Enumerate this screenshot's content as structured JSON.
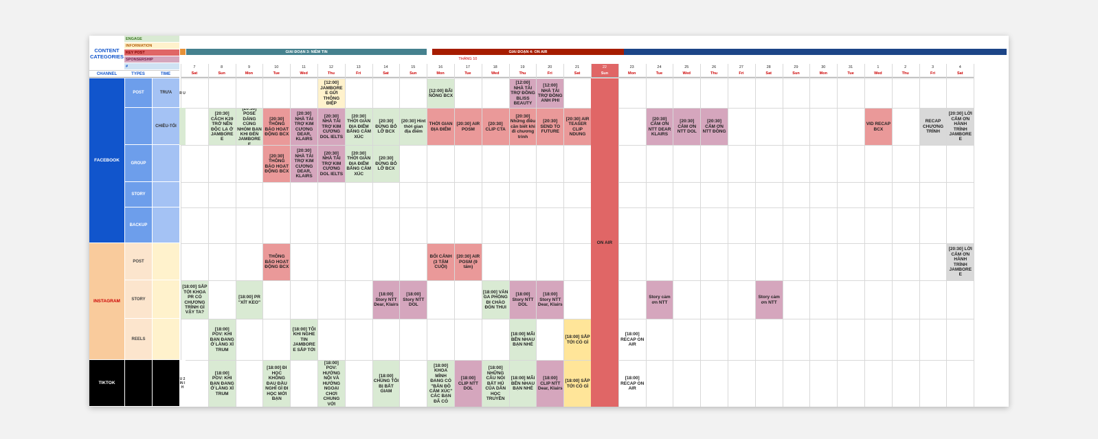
{
  "legend": {
    "title": "CONTENT CATEGORIES",
    "items": [
      {
        "label": "ENGAGE",
        "color": "#d9ead3",
        "text": "#38761d"
      },
      {
        "label": "INFORMATION",
        "color": "#fff2cc",
        "text": "#b45f06"
      },
      {
        "label": "KEY POST",
        "color": "#e06666",
        "text": "#7f0000"
      },
      {
        "label": "SPONSERSHIP",
        "color": "#d5a6bd",
        "text": "#741b47"
      },
      {
        "label": "#",
        "color": "#cfe2f3",
        "text": "#1155cc"
      }
    ]
  },
  "phases": [
    {
      "label": "GIAI ĐOẠN 3: NIỀM TIN",
      "color": "#45818e",
      "start": 0,
      "end": 9
    },
    {
      "label": "GIAI ĐOẠN 4: ON AIR",
      "color": "#a61c00",
      "start": 9,
      "end": 16
    },
    {
      "label": "",
      "color": "#1c4587",
      "start": 16,
      "end": 30
    }
  ],
  "month_label": "THÁNG 10",
  "headers": {
    "channel": "CHANNEL",
    "types": "TYPES",
    "time": "TIME"
  },
  "days": [
    {
      "d": "7",
      "w": "Sat"
    },
    {
      "d": "8",
      "w": "Sun"
    },
    {
      "d": "9",
      "w": "Mon"
    },
    {
      "d": "10",
      "w": "Tue"
    },
    {
      "d": "11",
      "w": "Wed"
    },
    {
      "d": "12",
      "w": "Thu"
    },
    {
      "d": "13",
      "w": "Fri"
    },
    {
      "d": "14",
      "w": "Sat"
    },
    {
      "d": "15",
      "w": "Sun"
    },
    {
      "d": "16",
      "w": "Mon"
    },
    {
      "d": "17",
      "w": "Tue"
    },
    {
      "d": "18",
      "w": "Wed"
    },
    {
      "d": "19",
      "w": "Thu"
    },
    {
      "d": "20",
      "w": "Fri"
    },
    {
      "d": "21",
      "w": "Sat"
    },
    {
      "d": "22",
      "w": "Sun"
    },
    {
      "d": "23",
      "w": "Mon"
    },
    {
      "d": "24",
      "w": "Tue"
    },
    {
      "d": "25",
      "w": "Wed"
    },
    {
      "d": "26",
      "w": "Thu"
    },
    {
      "d": "27",
      "w": "Fri"
    },
    {
      "d": "28",
      "w": "Sat"
    },
    {
      "d": "29",
      "w": "Sun"
    },
    {
      "d": "30",
      "w": "Mon"
    },
    {
      "d": "31",
      "w": "Tue"
    },
    {
      "d": "1",
      "w": "Wed"
    },
    {
      "d": "2",
      "w": "Thu"
    },
    {
      "d": "3",
      "w": "Fri"
    },
    {
      "d": "4",
      "w": "Sat"
    }
  ],
  "on_air_label": "ON AIR",
  "channels": [
    {
      "label": "FACEBOOK",
      "color": "#1155cc",
      "text_color": "#ffffff",
      "rows": [
        0,
        5
      ]
    },
    {
      "label": "INSTAGRAM",
      "color": "#f9cb9c",
      "text_color": "#cc0000",
      "rows": [
        5,
        8
      ]
    },
    {
      "label": "TIKTOK",
      "color": "#000000",
      "text_color": "#ffffff",
      "rows": [
        8,
        9
      ]
    }
  ],
  "rows": [
    {
      "type": "POST",
      "time": "TRƯA",
      "ch": 0
    },
    {
      "type": "",
      "time": "CHIỀU-TỐI",
      "ch": 0
    },
    {
      "type": "GROUP",
      "time": "",
      "ch": 0
    },
    {
      "type": "STORY",
      "time": "",
      "ch": 0
    },
    {
      "type": "BACKUP",
      "time": "",
      "ch": 0
    },
    {
      "type": "POST",
      "time": "",
      "ch": 1
    },
    {
      "type": "STORY",
      "time": "",
      "ch": 1
    },
    {
      "type": "REELS",
      "time": "",
      "ch": 1
    },
    {
      "type": "",
      "time": "",
      "ch": 2
    }
  ],
  "stub_text": [
    "R U",
    "",
    "",
    "",
    "",
    "",
    "",
    "",
    "U 2 IN IH"
  ],
  "colors": {
    "engage": "#d9ead3",
    "info": "#fff2cc",
    "key": "#ea9999",
    "spons": "#d5a6bd",
    "gray": "#d9d9d9",
    "yellow": "#ffe599",
    "onair": "#e06666"
  },
  "events": [
    {
      "r": 0,
      "c": 5,
      "k": "info",
      "t": "[12:00] JAMBOREE GỬI THÔNG ĐIỆP"
    },
    {
      "r": 0,
      "c": 9,
      "k": "engage",
      "t": "[12:00] BÃI NÔNG BCX"
    },
    {
      "r": 0,
      "c": 12,
      "k": "spons",
      "t": "[12:00] NHÀ TÀI TRỢ ĐỒNG BLISS BEAUTY"
    },
    {
      "r": 0,
      "c": 13,
      "k": "spons",
      "t": "[12:00] NHÀ TÀI TRỢ ĐỒNG ANH PHI"
    },
    {
      "r": 1,
      "c": 1,
      "k": "engage",
      "t": "[20:30] CÁCH K29 TRỞ NÊN ĐỘC LẠ Ở JAMBOREE"
    },
    {
      "r": 1,
      "c": 2,
      "k": "engage",
      "t": "[20:30] POSE DÁNG CÙNG NHÓM BẠN KHI ĐẾN JAMBOREE"
    },
    {
      "r": 1,
      "c": 3,
      "k": "key",
      "t": "[20:30] THÔNG BÁO HOẠT ĐỘNG BCX"
    },
    {
      "r": 1,
      "c": 4,
      "k": "spons",
      "t": "[20:30] NHÀ TÀI TRỢ KIM CƯƠNG DEAR, KLAIRS"
    },
    {
      "r": 1,
      "c": 5,
      "k": "spons",
      "t": "[20:30] NHÀ TÀI TRỢ KIM CƯƠNG DOL IELTS"
    },
    {
      "r": 1,
      "c": 6,
      "k": "engage",
      "t": "[20:30] THỜI GIAN ĐỊA ĐIỂM BẰNG CẢM XÚC"
    },
    {
      "r": 1,
      "c": 7,
      "k": "engage",
      "t": "[20:30] ĐỪNG BỎ LỠ BCX"
    },
    {
      "r": 1,
      "c": 8,
      "k": "engage",
      "t": "[20:30] Hint thời gian địa điểm"
    },
    {
      "r": 1,
      "c": 9,
      "k": "key",
      "t": "THỜI GIAN ĐỊA ĐIỂM"
    },
    {
      "r": 1,
      "c": 10,
      "k": "key",
      "t": "[20:30] AIR POSM"
    },
    {
      "r": 1,
      "c": 11,
      "k": "key",
      "t": "[20:30] CLIP CTA"
    },
    {
      "r": 1,
      "c": 12,
      "k": "key",
      "t": "[20:30] Những điều cần biết khi đi chương trình"
    },
    {
      "r": 1,
      "c": 13,
      "k": "key",
      "t": "[20:30] SEND TO FUTURE"
    },
    {
      "r": 1,
      "c": 14,
      "k": "key",
      "t": "[20:30] AIR TEASER CLIP NDUNG"
    },
    {
      "r": 1,
      "c": 17,
      "k": "spons",
      "t": "[20:30] CẢM ƠN NTT DEAR KLAIRS"
    },
    {
      "r": 1,
      "c": 18,
      "k": "spons",
      "t": "[20:30] CẢM ƠN NTT DOL"
    },
    {
      "r": 1,
      "c": 19,
      "k": "spons",
      "t": "[20:30] CẢM ƠN NTT ĐỒNG"
    },
    {
      "r": 1,
      "c": 25,
      "k": "key",
      "t": "VID RECAP BCX"
    },
    {
      "r": 1,
      "c": 27,
      "k": "gray",
      "t": "RECAP CHƯƠNG TRÌNH"
    },
    {
      "r": 1,
      "c": 28,
      "k": "gray",
      "t": "[20:30] LỜI CẢM ƠN HÀNH TRÌNH JAMBOREE"
    },
    {
      "r": 2,
      "c": 3,
      "k": "key",
      "t": "[20:30] THÔNG BÁO HOẠT ĐỘNG BCX"
    },
    {
      "r": 2,
      "c": 4,
      "k": "spons",
      "t": "[20:30] NHÀ TÀI TRỢ KIM CƯƠNG DEAR, KLAIRS"
    },
    {
      "r": 2,
      "c": 5,
      "k": "spons",
      "t": "[20:30] NHÀ TÀI TRỢ KIM CƯƠNG DOL IELTS"
    },
    {
      "r": 2,
      "c": 6,
      "k": "engage",
      "t": "[20:30] THỜI GIAN ĐỊA ĐIỂM BẰNG CẢM XÚC"
    },
    {
      "r": 2,
      "c": 7,
      "k": "engage",
      "t": "[20:30] ĐỪNG BỎ LỠ BCX"
    },
    {
      "r": 5,
      "c": 3,
      "k": "key",
      "t": "THÔNG BÁO HOẠT ĐỘNG BCX"
    },
    {
      "r": 5,
      "c": 9,
      "k": "key",
      "t": "BỐI CẢNH (3 TẤM CUỘI)"
    },
    {
      "r": 5,
      "c": 10,
      "k": "key",
      "t": "[20:30] AIR POSM (9 tấm)"
    },
    {
      "r": 5,
      "c": 28,
      "k": "gray",
      "t": "[20:30] LỜI CẢM ƠN HÀNH TRÌNH JAMBOREE"
    },
    {
      "r": 6,
      "c": 0,
      "k": "engage",
      "t": "[18:00] SẮP TỚI KHOA PR CÓ CHƯƠNG TRÌNH GÌ VẬY TA?"
    },
    {
      "r": 6,
      "c": 2,
      "k": "engage",
      "t": "[18:00] PR \"XÍT KEO\""
    },
    {
      "r": 6,
      "c": 7,
      "k": "spons",
      "t": "[18:00] Story NTT Dear, Klairs"
    },
    {
      "r": 6,
      "c": 8,
      "k": "spons",
      "t": "[18:00] Story NTT DOL"
    },
    {
      "r": 6,
      "c": 11,
      "k": "engage",
      "t": "[18:00] VĂN GA PHÒNG ĐI CHÀO ĐÓN THUI"
    },
    {
      "r": 6,
      "c": 12,
      "k": "spons",
      "t": "[18:00] Story NTT DOL"
    },
    {
      "r": 6,
      "c": 13,
      "k": "spons",
      "t": "[18:00] Story NTT Dear, Klairs"
    },
    {
      "r": 6,
      "c": 17,
      "k": "spons",
      "t": "Story cảm ơn NTT"
    },
    {
      "r": 6,
      "c": 21,
      "k": "spons",
      "t": "Story cảm ơn NTT"
    },
    {
      "r": 7,
      "c": 1,
      "k": "engage",
      "t": "[18:00] POV: KHI BẠN ĐANG Ở LÀNG XÌ TRUM"
    },
    {
      "r": 7,
      "c": 4,
      "k": "engage",
      "t": "[18:00] TÔI KHI NGHE TIN JAMBOREE SẮP TỚI"
    },
    {
      "r": 7,
      "c": 12,
      "k": "engage",
      "t": "[18:00] MÃI BÊN NHAU BẠN NHÉ"
    },
    {
      "r": 7,
      "c": 14,
      "k": "yellow",
      "t": "[18:00] SẮP TỚI CÓ GÌ"
    },
    {
      "r": 7,
      "c": 16,
      "k": "none",
      "t": "[18:00] RECAP ON AIR"
    },
    {
      "r": 8,
      "c": 1,
      "k": "engage",
      "t": "[18:00] POV: KHI BẠN ĐANG Ở LÀNG XÌ TRUM"
    },
    {
      "r": 8,
      "c": 3,
      "k": "engage",
      "t": "[18:00] ĐI HỌC KHÔNG ĐAU ĐẦU NGHĨ GÌ ĐI HỌC MỚI BẠN"
    },
    {
      "r": 8,
      "c": 5,
      "k": "engage",
      "t": "[18:00] POV: HƯỚNG NỘI VÀ HƯỚNG NGOẠI CHƠI CHUNG VỚI"
    },
    {
      "r": 8,
      "c": 7,
      "k": "engage",
      "t": "[18:00] CHÚNG TÔI BỊ BẮT GIAM"
    },
    {
      "r": 8,
      "c": 9,
      "k": "engage",
      "t": "[18:00] KHOA MÌNH ĐANG CÓ \"BẢN ĐỒ CẢM XÚC\" CÁC BẠN ĐÃ CÓ"
    },
    {
      "r": 8,
      "c": 10,
      "k": "spons",
      "t": "[18:00] CLIP NTT DOL"
    },
    {
      "r": 8,
      "c": 11,
      "k": "engage",
      "t": "[18:00] NHỮNG CÂU NÓI BẤT HỦ CỦA DÂN HỌC TRUYỀN"
    },
    {
      "r": 8,
      "c": 12,
      "k": "engage",
      "t": "[18:00] MÃI BÊN NHAU BẠN NHÉ"
    },
    {
      "r": 8,
      "c": 13,
      "k": "spons",
      "t": "[18:00] CLIP NTT Dear, Klairs"
    },
    {
      "r": 8,
      "c": 14,
      "k": "yellow",
      "t": "[18:00] SẮP TỚI CÓ GÌ"
    },
    {
      "r": 8,
      "c": 16,
      "k": "none",
      "t": "[18:00] RECAP ON AIR"
    }
  ]
}
